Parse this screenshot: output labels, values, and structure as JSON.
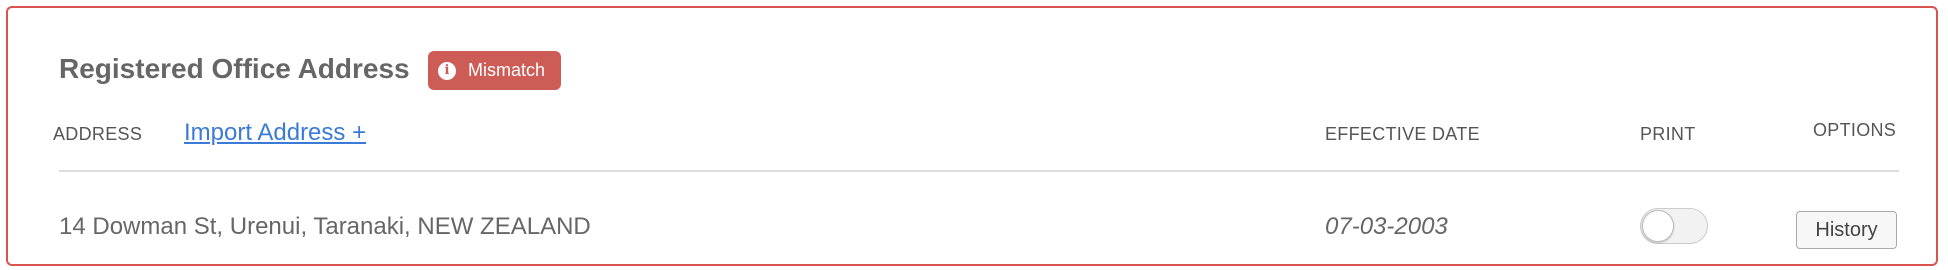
{
  "section": {
    "title": "Registered Office Address",
    "badge": {
      "label": "Mismatch",
      "icon": "info-icon",
      "color": "#cd5c57"
    }
  },
  "columns": {
    "address": "ADDRESS",
    "import_link": "Import Address +",
    "effective_date": "EFFECTIVE DATE",
    "print": "PRINT",
    "options": "OPTIONS"
  },
  "rows": [
    {
      "address": "14 Dowman St, Urenui, Taranaki, NEW ZEALAND",
      "effective_date": "07-03-2003",
      "print_enabled": false,
      "history_label": "History"
    }
  ],
  "colors": {
    "border": "#d9534f",
    "link": "#3b7bd8"
  }
}
